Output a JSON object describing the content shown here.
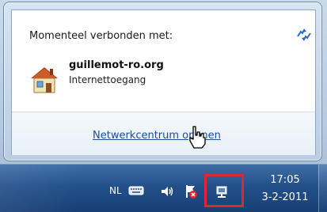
{
  "flyout": {
    "connected_label": "Momenteel verbonden met:",
    "network_name": "guillemot-ro.org",
    "network_status": "Internettoegang",
    "footer_link": "Netwerkcentrum openen",
    "icons": {
      "refresh": "refresh-icon",
      "network": "house-network-icon",
      "cursor": "hand-cursor-icon"
    }
  },
  "taskbar": {
    "language": "NL",
    "clock_time": "17:05",
    "clock_date": "3-2-2011",
    "icons": [
      "keyboard-icon",
      "volume-icon",
      "action-center-icon",
      "network-tray-icon"
    ],
    "highlight_color": "#e0262f"
  }
}
